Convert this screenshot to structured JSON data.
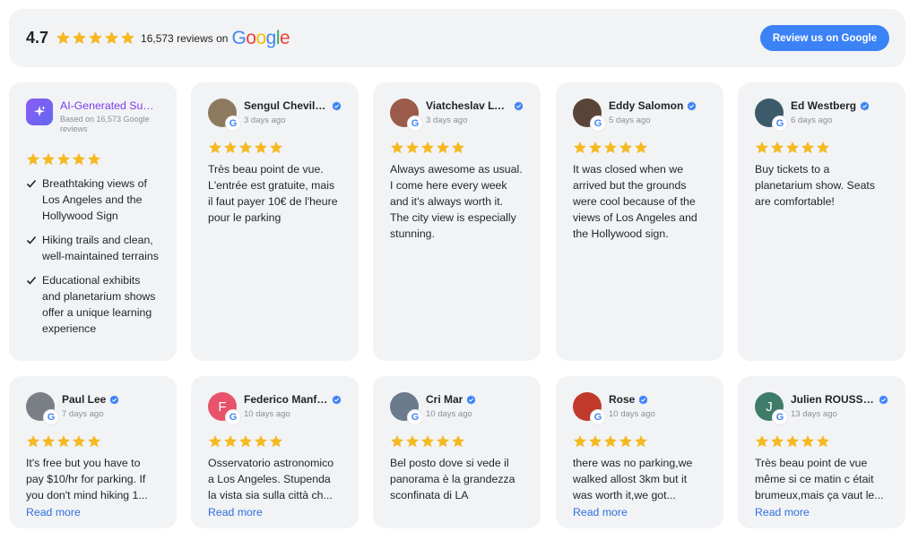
{
  "header": {
    "rating": "4.7",
    "stars": 5,
    "count_text": "16,573 reviews on",
    "google_letters": [
      "G",
      "o",
      "o",
      "g",
      "l",
      "e"
    ],
    "button_label": "Review us on Google"
  },
  "ai_card": {
    "title": "AI-Generated Summary",
    "subtitle": "Based on 16,573 Google reviews",
    "stars": 5,
    "points": [
      "Breathtaking views of Los Angeles and the Hollywood Sign",
      "Hiking trails and clean, well-maintained terrains",
      "Educational exhibits and planetarium shows offer a unique learning experience"
    ]
  },
  "reviews": [
    {
      "name": "Sengul Chevillon",
      "time": "3 days ago",
      "stars": 5,
      "text": "Très beau point de vue. L'entrée est gratuite, mais il faut payer 10€ de l'heure pour le parking",
      "avatar_color": "#8d7a5e",
      "avatar_letter": ""
    },
    {
      "name": "Viatcheslav Lyakhov",
      "time": "3 days ago",
      "stars": 5,
      "text": "Always awesome as usual. I come here every week and it's always worth it. The city view is especially stunning.",
      "avatar_color": "#9a5b4a",
      "avatar_letter": ""
    },
    {
      "name": "Eddy Salomon",
      "time": "5 days ago",
      "stars": 5,
      "text": "It was closed when we arrived but the grounds were cool because of the views of Los Angeles and the Hollywood sign.",
      "avatar_color": "#5a4438",
      "avatar_letter": ""
    },
    {
      "name": "Ed Westberg",
      "time": "6 days ago",
      "stars": 5,
      "text": "Buy tickets to a planetarium show. Seats are comfortable!",
      "avatar_color": "#3d5a6b",
      "avatar_letter": ""
    },
    {
      "name": "Paul Lee",
      "time": "7 days ago",
      "stars": 5,
      "text": "It's free but you have to pay $10/hr for parking. If you don't mind hiking 1...",
      "avatar_color": "#7a7f86",
      "avatar_letter": "",
      "read_more": "Read more"
    },
    {
      "name": "Federico Manfredi",
      "time": "10 days ago",
      "stars": 5,
      "text": "Osservatorio astronomico a Los Angeles. Stupenda la vista sia sulla città ch...",
      "avatar_color": "#e8536b",
      "avatar_letter": "F",
      "read_more": "Read more"
    },
    {
      "name": "Cri Mar",
      "time": "10 days ago",
      "stars": 5,
      "text": "Bel posto dove si vede il panorama è la grandezza sconfinata di LA",
      "avatar_color": "#6b7a8c",
      "avatar_letter": ""
    },
    {
      "name": "Rose",
      "time": "10 days ago",
      "stars": 5,
      "text": "there was no parking,we walked allost 3km but it was worth it,we got...",
      "avatar_color": "#c0392b",
      "avatar_letter": "",
      "read_more": "Read more"
    },
    {
      "name": "Julien ROUSSEL",
      "time": "13 days ago",
      "stars": 5,
      "text": "Très beau point de vue même si ce matin c était brumeux,mais ça vaut le...",
      "avatar_color": "#3e7b68",
      "avatar_letter": "J",
      "read_more": "Read more"
    }
  ],
  "colors": {
    "star": "#f5b921",
    "accent_button": "#3b82f6",
    "link": "#2f6fe0",
    "verified": "#3b82f6"
  },
  "icons": [
    "star-icon",
    "google-g-icon",
    "verified-badge-icon",
    "ai-sparkle-icon",
    "check-icon"
  ]
}
